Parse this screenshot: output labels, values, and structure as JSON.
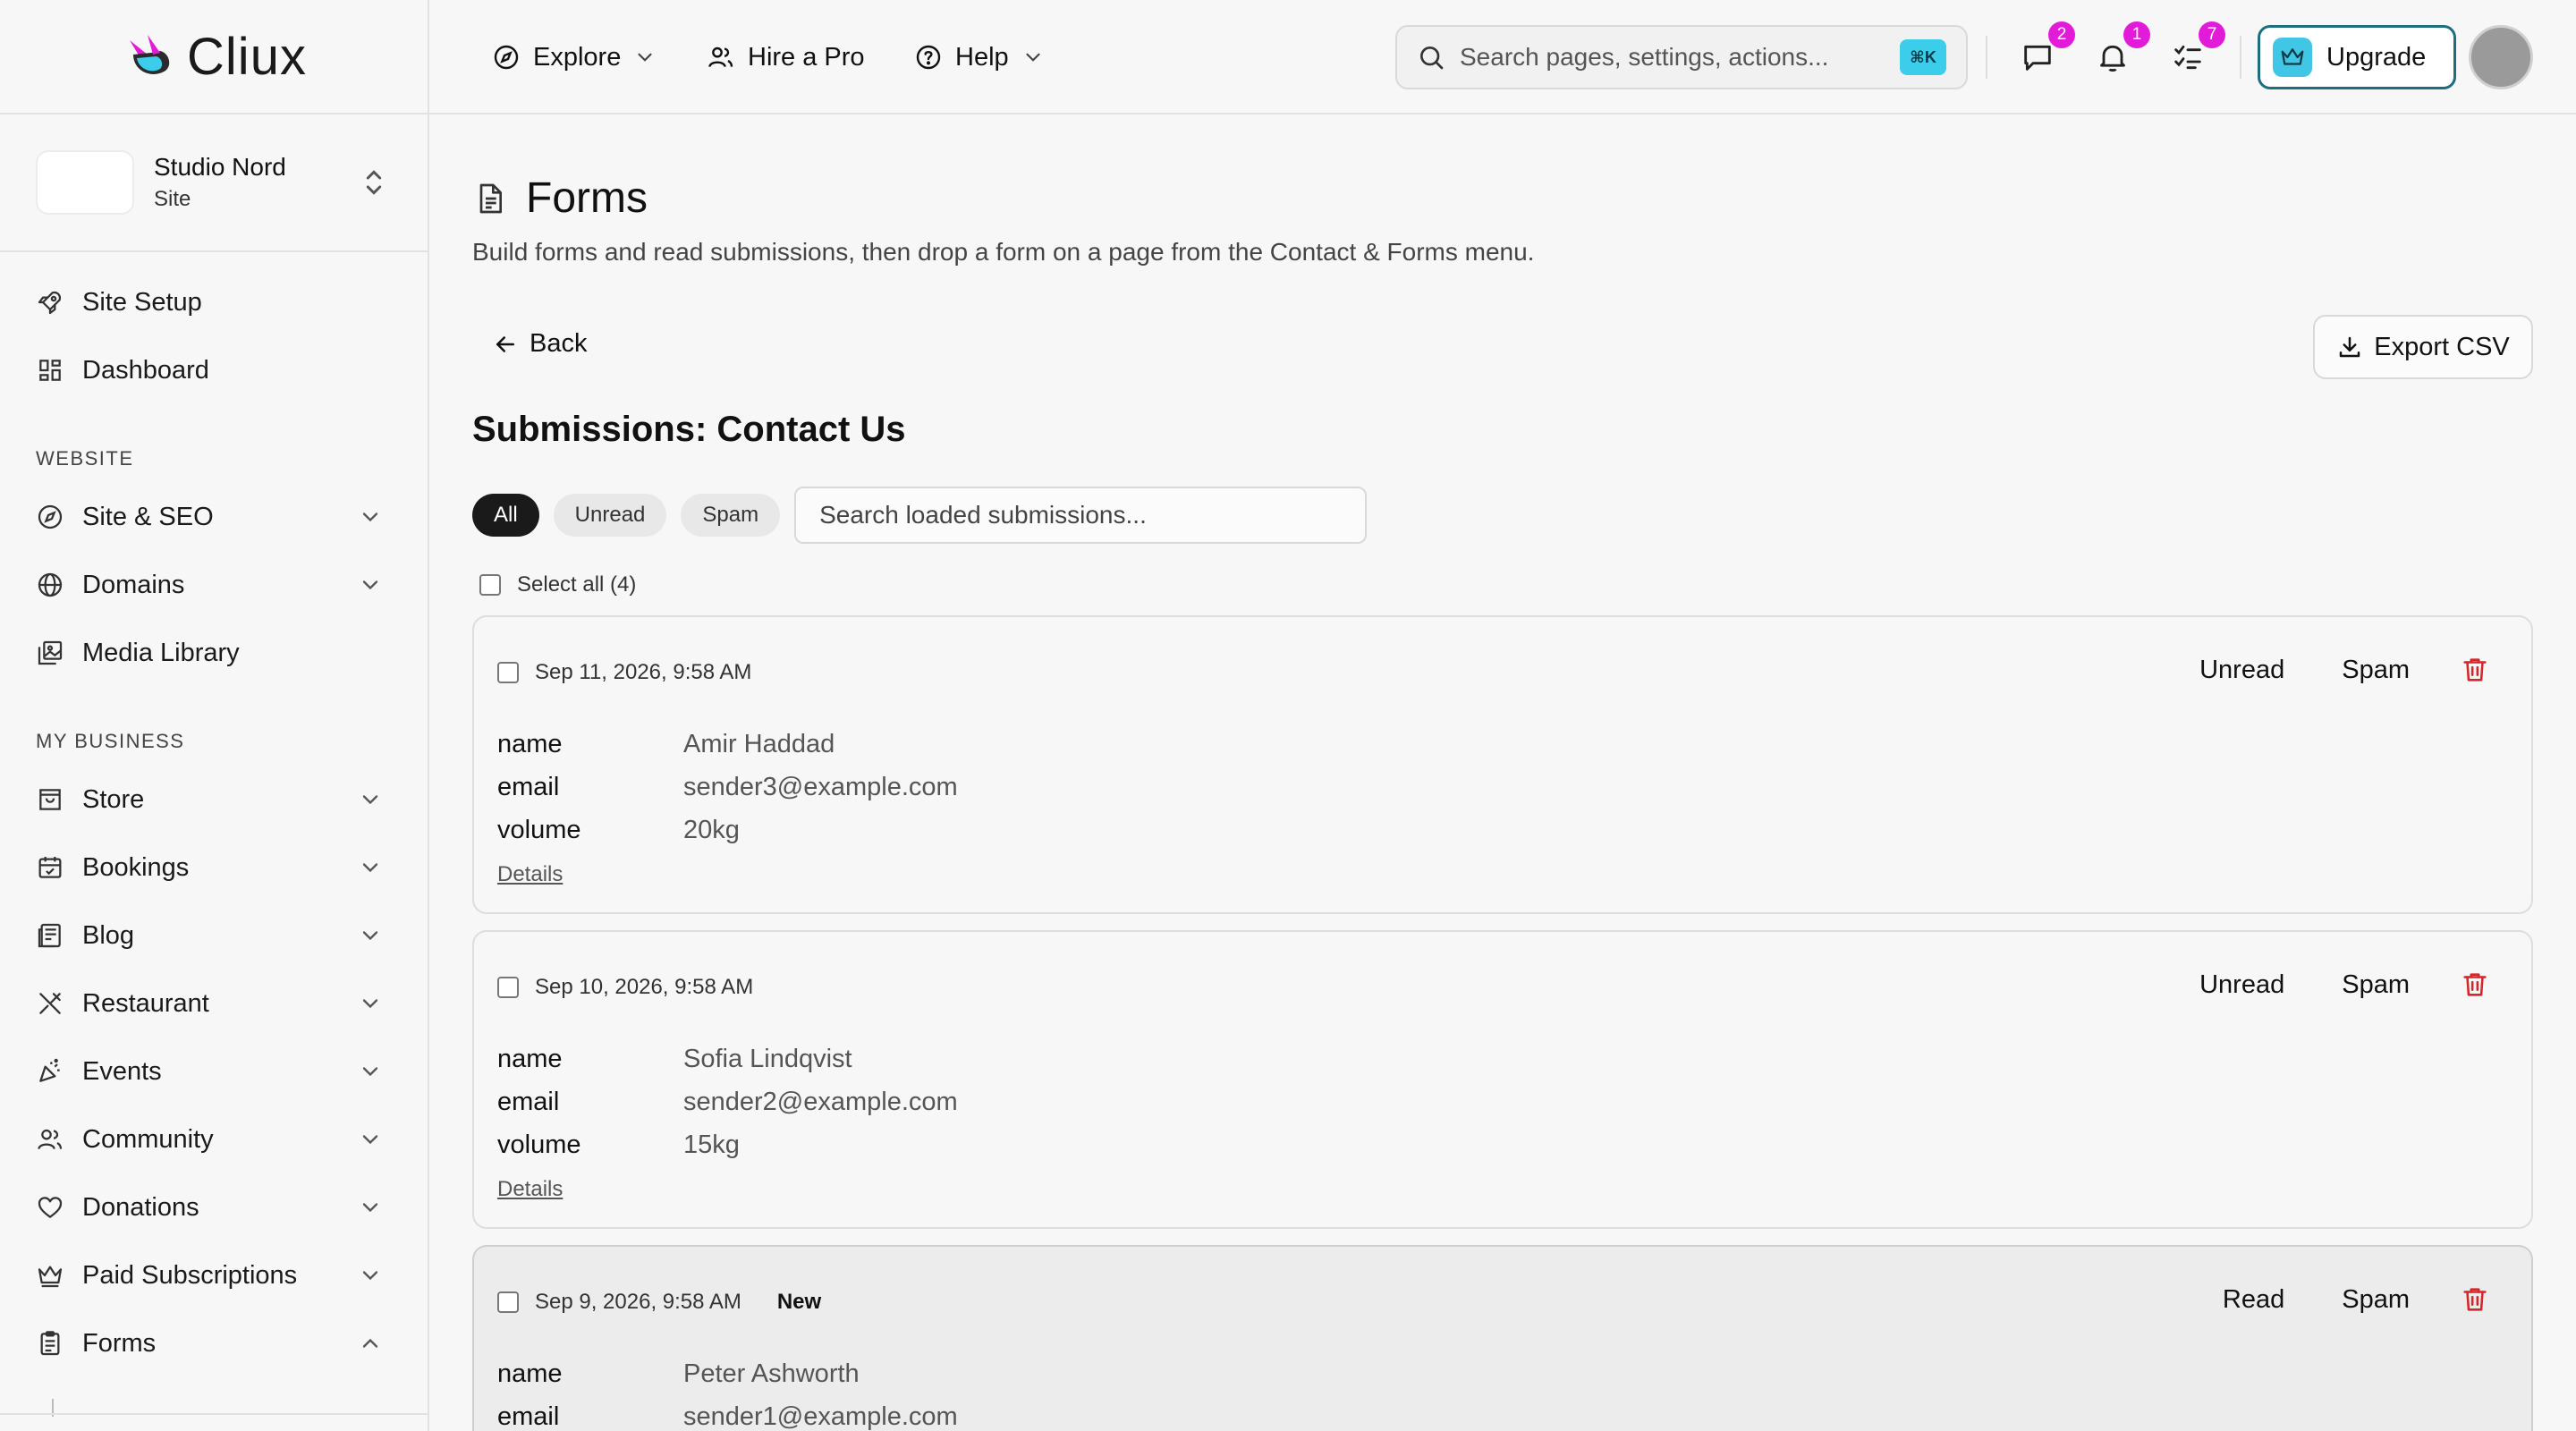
{
  "brand": {
    "name": "Cliux"
  },
  "site": {
    "name": "Studio Nord",
    "type": "Site"
  },
  "sidebar": {
    "top_items": [
      {
        "label": "Site Setup",
        "icon": "rocket-icon"
      },
      {
        "label": "Dashboard",
        "icon": "dashboard-icon"
      }
    ],
    "sections": [
      {
        "title": "WEBSITE",
        "items": [
          {
            "label": "Site & SEO",
            "icon": "compass-icon",
            "expandable": true
          },
          {
            "label": "Domains",
            "icon": "globe-icon",
            "expandable": true
          },
          {
            "label": "Media Library",
            "icon": "media-icon",
            "expandable": false
          }
        ]
      },
      {
        "title": "MY BUSINESS",
        "items": [
          {
            "label": "Store",
            "icon": "store-icon",
            "expandable": true
          },
          {
            "label": "Bookings",
            "icon": "calendar-icon",
            "expandable": true
          },
          {
            "label": "Blog",
            "icon": "blog-icon",
            "expandable": true
          },
          {
            "label": "Restaurant",
            "icon": "utensils-icon",
            "expandable": true
          },
          {
            "label": "Events",
            "icon": "party-icon",
            "expandable": true
          },
          {
            "label": "Community",
            "icon": "users-icon",
            "expandable": true
          },
          {
            "label": "Donations",
            "icon": "heart-icon",
            "expandable": true
          },
          {
            "label": "Paid Subscriptions",
            "icon": "crown-icon",
            "expandable": true
          },
          {
            "label": "Forms",
            "icon": "clipboard-icon",
            "expandable": true,
            "expanded": true
          }
        ]
      }
    ]
  },
  "topbar": {
    "explore": "Explore",
    "hire": "Hire a Pro",
    "help": "Help",
    "search_placeholder": "Search pages, settings, actions...",
    "search_shortcut": "⌘K",
    "badges": {
      "messages": "2",
      "notifications": "1",
      "tasks": "7"
    },
    "upgrade": "Upgrade"
  },
  "page": {
    "title": "Forms",
    "subtitle": "Build forms and read submissions, then drop a form on a page from the Contact & Forms menu.",
    "back": "Back",
    "export": "Export CSV",
    "submissions_title": "Submissions: Contact Us",
    "filters": [
      "All",
      "Unread",
      "Spam"
    ],
    "filter_search_placeholder": "Search loaded submissions...",
    "select_all": "Select all (4)"
  },
  "submissions": [
    {
      "date": "Sep 11, 2026, 9:58 AM",
      "tag": "",
      "read_action": "Unread",
      "spam_action": "Spam",
      "fields": [
        [
          "name",
          "Amir Haddad"
        ],
        [
          "email",
          "sender3@example.com"
        ],
        [
          "volume",
          "20kg"
        ]
      ],
      "details": "Details"
    },
    {
      "date": "Sep 10, 2026, 9:58 AM",
      "tag": "",
      "read_action": "Unread",
      "spam_action": "Spam",
      "fields": [
        [
          "name",
          "Sofia Lindqvist"
        ],
        [
          "email",
          "sender2@example.com"
        ],
        [
          "volume",
          "15kg"
        ]
      ],
      "details": "Details"
    },
    {
      "date": "Sep 9, 2026, 9:58 AM",
      "tag": "New",
      "read_action": "Read",
      "spam_action": "Spam",
      "fields": [
        [
          "name",
          "Peter Ashworth"
        ],
        [
          "email",
          "sender1@example.com"
        ]
      ],
      "details": ""
    }
  ]
}
